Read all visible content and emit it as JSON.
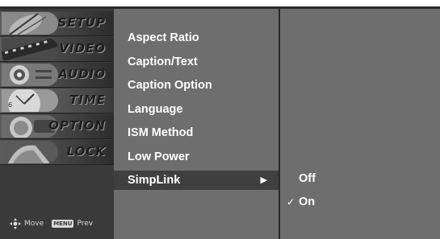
{
  "categories": [
    {
      "label": "SETUP",
      "icon": "satellite-dish-icon"
    },
    {
      "label": "VIDEO",
      "icon": "film-reel-icon"
    },
    {
      "label": "AUDIO",
      "icon": "speaker-icon"
    },
    {
      "label": "TIME",
      "icon": "clock-icon"
    },
    {
      "label": "OPTION",
      "icon": "option-dial-icon"
    },
    {
      "label": "LOCK",
      "icon": "lock-icon"
    }
  ],
  "hints": {
    "move": "Move",
    "menu_key": "MENU",
    "prev": "Prev"
  },
  "options": [
    {
      "label": "Aspect Ratio"
    },
    {
      "label": "Caption/Text"
    },
    {
      "label": "Caption Option"
    },
    {
      "label": "Language"
    },
    {
      "label": "ISM Method"
    },
    {
      "label": "Low Power"
    },
    {
      "label": "SimpLink",
      "arrow": "▶"
    }
  ],
  "suboptions": [
    {
      "label": "Off",
      "check": ""
    },
    {
      "label": "On",
      "check": "✓"
    }
  ],
  "colors": {
    "background": "#6e6e6e",
    "sidebar": "#3a3a3a",
    "selected": "#3f3f3f",
    "text": "#ffffff"
  }
}
